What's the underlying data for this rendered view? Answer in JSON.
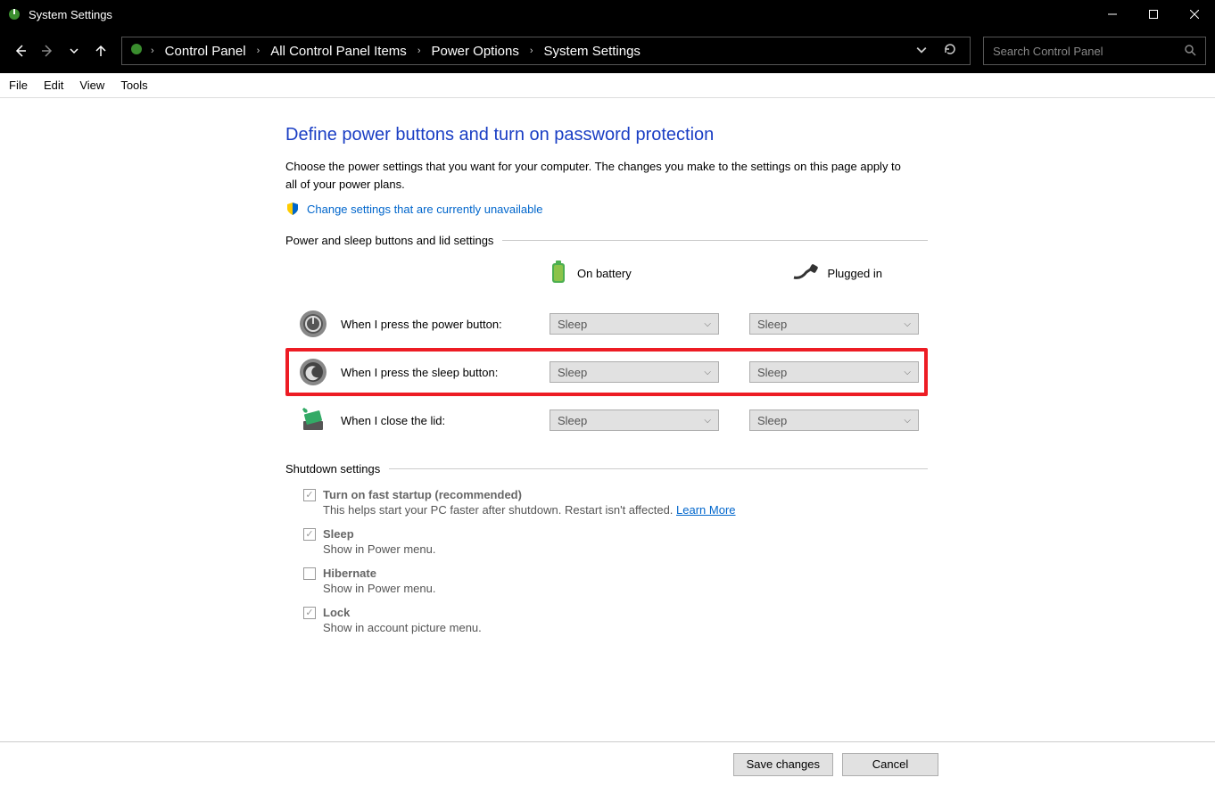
{
  "window": {
    "title": "System Settings"
  },
  "breadcrumb": {
    "items": [
      "Control Panel",
      "All Control Panel Items",
      "Power Options",
      "System Settings"
    ]
  },
  "search": {
    "placeholder": "Search Control Panel"
  },
  "menu": {
    "items": [
      "File",
      "Edit",
      "View",
      "Tools"
    ]
  },
  "page": {
    "title": "Define power buttons and turn on password protection",
    "description": "Choose the power settings that you want for your computer. The changes you make to the settings on this page apply to all of your power plans.",
    "admin_link": "Change settings that are currently unavailable"
  },
  "sections": {
    "power_lid": {
      "heading": "Power and sleep buttons and lid settings",
      "col_battery": "On battery",
      "col_plugged": "Plugged in",
      "rows": [
        {
          "label": "When I press the power button:",
          "battery": "Sleep",
          "plugged": "Sleep"
        },
        {
          "label": "When I press the sleep button:",
          "battery": "Sleep",
          "plugged": "Sleep"
        },
        {
          "label": "When I close the lid:",
          "battery": "Sleep",
          "plugged": "Sleep"
        }
      ]
    },
    "shutdown": {
      "heading": "Shutdown settings",
      "items": [
        {
          "checked": true,
          "title": "Turn on fast startup (recommended)",
          "sub": "This helps start your PC faster after shutdown. Restart isn't affected. ",
          "learn": "Learn More"
        },
        {
          "checked": true,
          "title": "Sleep",
          "sub": "Show in Power menu."
        },
        {
          "checked": false,
          "title": "Hibernate",
          "sub": "Show in Power menu."
        },
        {
          "checked": true,
          "title": "Lock",
          "sub": "Show in account picture menu."
        }
      ]
    }
  },
  "footer": {
    "save": "Save changes",
    "cancel": "Cancel"
  }
}
